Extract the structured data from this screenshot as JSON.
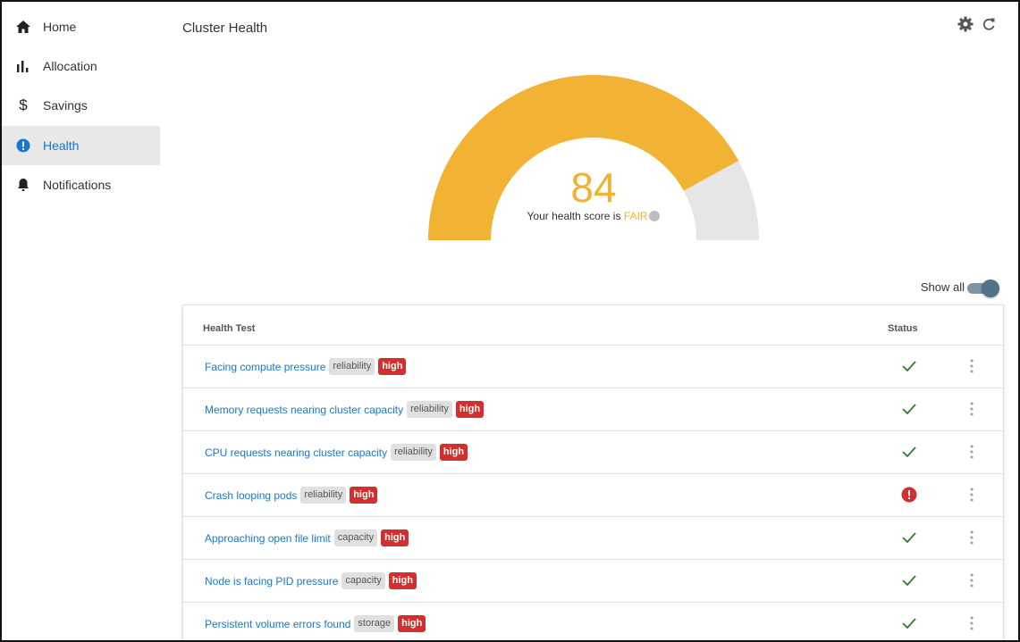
{
  "sidebar": {
    "items": [
      {
        "label": "Home",
        "icon": "home-icon"
      },
      {
        "label": "Allocation",
        "icon": "bar-chart-icon"
      },
      {
        "label": "Savings",
        "icon": "dollar-icon"
      },
      {
        "label": "Health",
        "icon": "alert-circle-icon",
        "active": true
      },
      {
        "label": "Notifications",
        "icon": "bell-icon"
      }
    ]
  },
  "header": {
    "title": "Cluster Health",
    "icons": [
      "gear-icon",
      "refresh-icon"
    ]
  },
  "gauge": {
    "score": "84",
    "max": 100,
    "message_prefix": "Your health score is ",
    "level": "FAIR",
    "fill_color": "#f2b233",
    "track_color": "#e6e6e6"
  },
  "toggle": {
    "label": "Show all",
    "on": true
  },
  "table": {
    "headers": {
      "test": "Health Test",
      "status": "Status"
    },
    "rows": [
      {
        "name": "Facing compute pressure",
        "category": "reliability",
        "severity": "high",
        "status": "ok"
      },
      {
        "name": "Memory requests nearing cluster capacity",
        "category": "reliability",
        "severity": "high",
        "status": "ok"
      },
      {
        "name": "CPU requests nearing cluster capacity",
        "category": "reliability",
        "severity": "high",
        "status": "ok"
      },
      {
        "name": "Crash looping pods",
        "category": "reliability",
        "severity": "high",
        "status": "error"
      },
      {
        "name": "Approaching open file limit",
        "category": "capacity",
        "severity": "high",
        "status": "ok"
      },
      {
        "name": "Node is facing PID pressure",
        "category": "capacity",
        "severity": "high",
        "status": "ok"
      },
      {
        "name": "Persistent volume errors found",
        "category": "storage",
        "severity": "high",
        "status": "ok"
      }
    ]
  },
  "colors": {
    "accent": "#1976d2",
    "ok": "#2e7d32",
    "error": "#d32f2f",
    "warning": "#f2b233"
  }
}
